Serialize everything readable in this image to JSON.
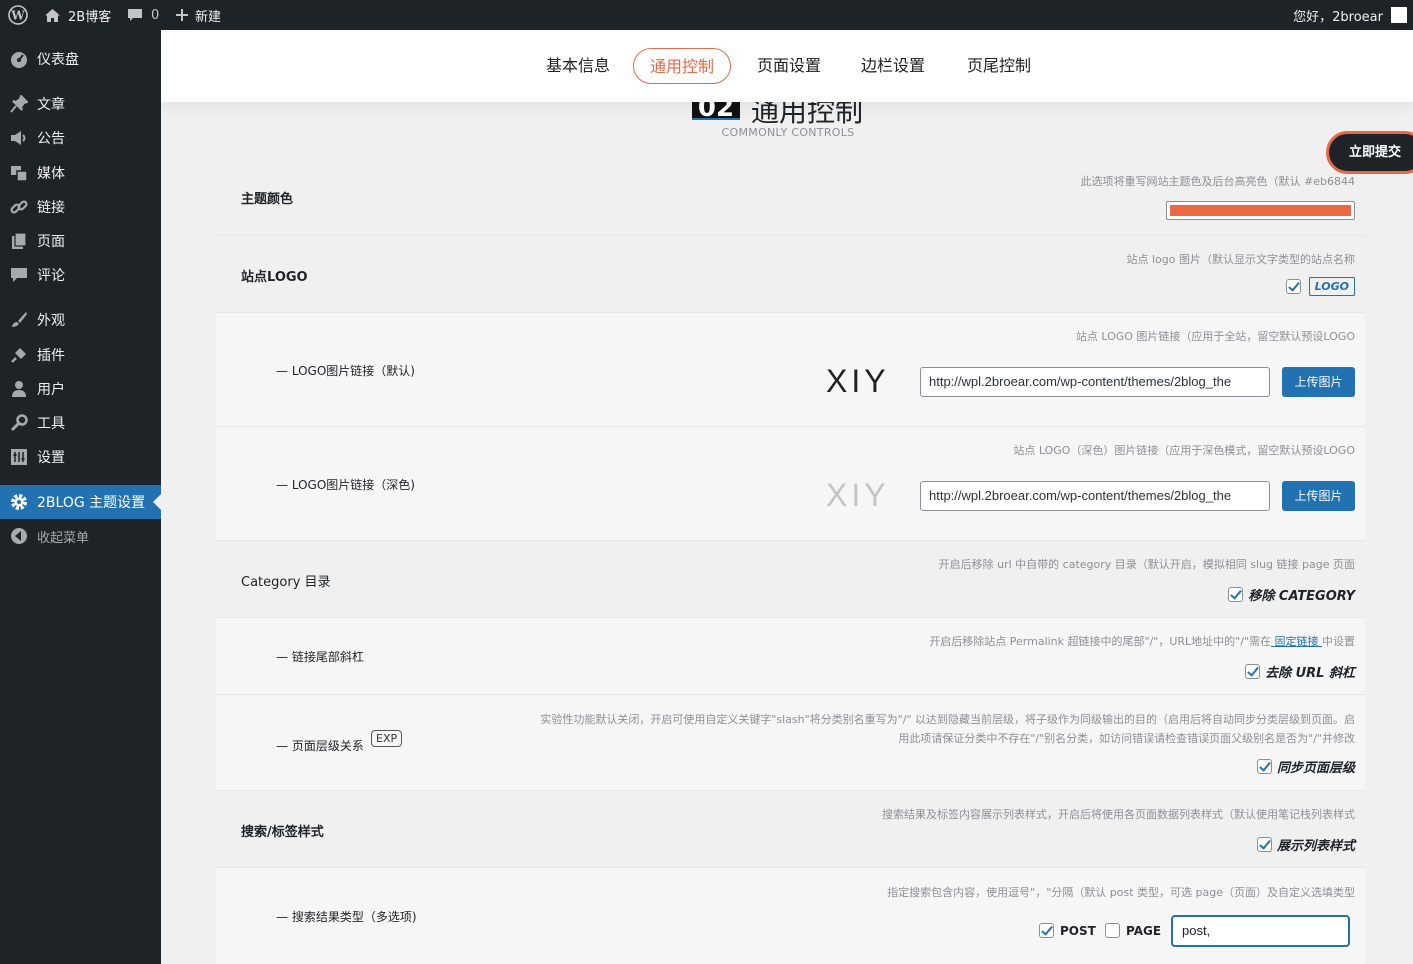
{
  "adminbar": {
    "site": "2B博客",
    "comments": "0",
    "new": "新建",
    "greeting": "您好，2broear"
  },
  "sidebar": {
    "items": [
      {
        "label": "仪表盘",
        "icon": "dashboard-icon"
      },
      {
        "label": "文章",
        "icon": "pin-icon"
      },
      {
        "label": "公告",
        "icon": "megaphone-icon"
      },
      {
        "label": "媒体",
        "icon": "media-icon"
      },
      {
        "label": "链接",
        "icon": "link-icon"
      },
      {
        "label": "页面",
        "icon": "page-icon"
      },
      {
        "label": "评论",
        "icon": "comment-icon"
      },
      {
        "label": "外观",
        "icon": "brush-icon"
      },
      {
        "label": "插件",
        "icon": "plug-icon"
      },
      {
        "label": "用户",
        "icon": "user-icon"
      },
      {
        "label": "工具",
        "icon": "wrench-icon"
      },
      {
        "label": "设置",
        "icon": "settings-icon"
      },
      {
        "label": "2BLOG 主题设置",
        "icon": "gear-icon"
      },
      {
        "label": "收起菜单",
        "icon": "collapse-icon"
      }
    ]
  },
  "tabs": [
    "基本信息",
    "通用控制",
    "页面设置",
    "边栏设置",
    "页尾控制"
  ],
  "section": {
    "number": "02",
    "title": "通用控制",
    "subtitle": "COMMONLY CONTROLS"
  },
  "submit": "立即提交",
  "colors": {
    "accent": "#eb6844",
    "wp_blue": "#2271b1",
    "admin_dark": "#1d2327"
  },
  "rows": {
    "theme_color": {
      "label": "主题颜色",
      "desc": "此选项将重写网站主题色及后台高亮色（默认 #eb6844",
      "value": "#eb6844"
    },
    "site_logo": {
      "label": "站点LOGO",
      "desc": "站点 logo 图片（默认显示文字类型的站点名称",
      "badge": "LOGO"
    },
    "logo_default": {
      "label": "— LOGO图片链接（默认)",
      "desc": "站点 LOGO 图片链接（应用于全站，留空默认预设LOGO",
      "preview": "XIY",
      "url": "http://wpl.2broear.com/wp-content/themes/2blog_the",
      "button": "上传图片"
    },
    "logo_dark": {
      "label": "— LOGO图片链接（深色)",
      "desc": "站点 LOGO（深色）图片链接（应用于深色模式，留空默认预设LOGO",
      "preview": "XIY",
      "url": "http://wpl.2broear.com/wp-content/themes/2blog_the",
      "button": "上传图片"
    },
    "category": {
      "label": "Category 目录",
      "desc": "开启后移除 url 中自带的 category 目录（默认开启，模拟相同 slug 链接 page 页面",
      "option": "移除 CATEGORY"
    },
    "slash": {
      "label": "— 链接尾部斜杠",
      "desc_pre": "开启后移除站点 Permalink 超链接中的尾部\"/\"，URL地址中的\"/\"需在",
      "desc_link": " 固定链接 ",
      "desc_post": "中设置",
      "option": "去除 URL 斜杠"
    },
    "hierarchy": {
      "label": "— 页面层级关系",
      "tag": "EXP",
      "desc1": "实验性功能默认关闭，开启可使用自定义关键字\"slash\"将分类别名重写为\"/\" 以达到隐藏当前层级，将子级作为同级输出的目的（启用后将自动同步分类层级到页面。启",
      "desc2": "用此项请保证分类中不存在\"/\"别名分类，如访问错误请检查错误页面父级别名是否为\"/\"并修改",
      "option": "同步页面层级"
    },
    "search_style": {
      "label": "搜索/标签样式",
      "desc": "搜索结果及标签内容展示列表样式，开启后将使用各页面数据列表样式（默认使用笔记栈列表样式",
      "option": "展示列表样式"
    },
    "search_type": {
      "label": "— 搜索结果类型（多选项)",
      "desc": "指定搜索包含内容，使用逗号\"，\"分隔（默认 post 类型，可选 page（页面）及自定义选填类型",
      "opt1": "POST",
      "opt2": "PAGE",
      "value": "post,"
    }
  }
}
